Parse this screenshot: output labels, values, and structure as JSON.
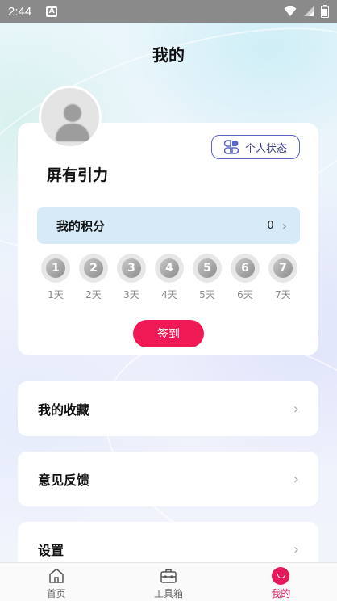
{
  "status_bar": {
    "time": "2:44",
    "notification_icon": "A"
  },
  "page_title": "我的",
  "profile": {
    "status_button_label": "个人状态",
    "user_name": "屏有引力",
    "points": {
      "label": "我的积分",
      "value": "0"
    },
    "checkin_days": [
      {
        "number": "1",
        "label": "1天"
      },
      {
        "number": "2",
        "label": "2天"
      },
      {
        "number": "3",
        "label": "3天"
      },
      {
        "number": "4",
        "label": "4天"
      },
      {
        "number": "5",
        "label": "5天"
      },
      {
        "number": "6",
        "label": "6天"
      },
      {
        "number": "7",
        "label": "7天"
      }
    ],
    "signin_button_label": "签到"
  },
  "menu": {
    "favorites": "我的收藏",
    "feedback": "意见反馈",
    "settings": "设置"
  },
  "bottom_nav": {
    "home": "首页",
    "toolbox": "工具箱",
    "me": "我的"
  },
  "colors": {
    "accent": "#ef1a55",
    "points_bg": "#d6ebf7",
    "status_button_border": "#5a63c8"
  }
}
